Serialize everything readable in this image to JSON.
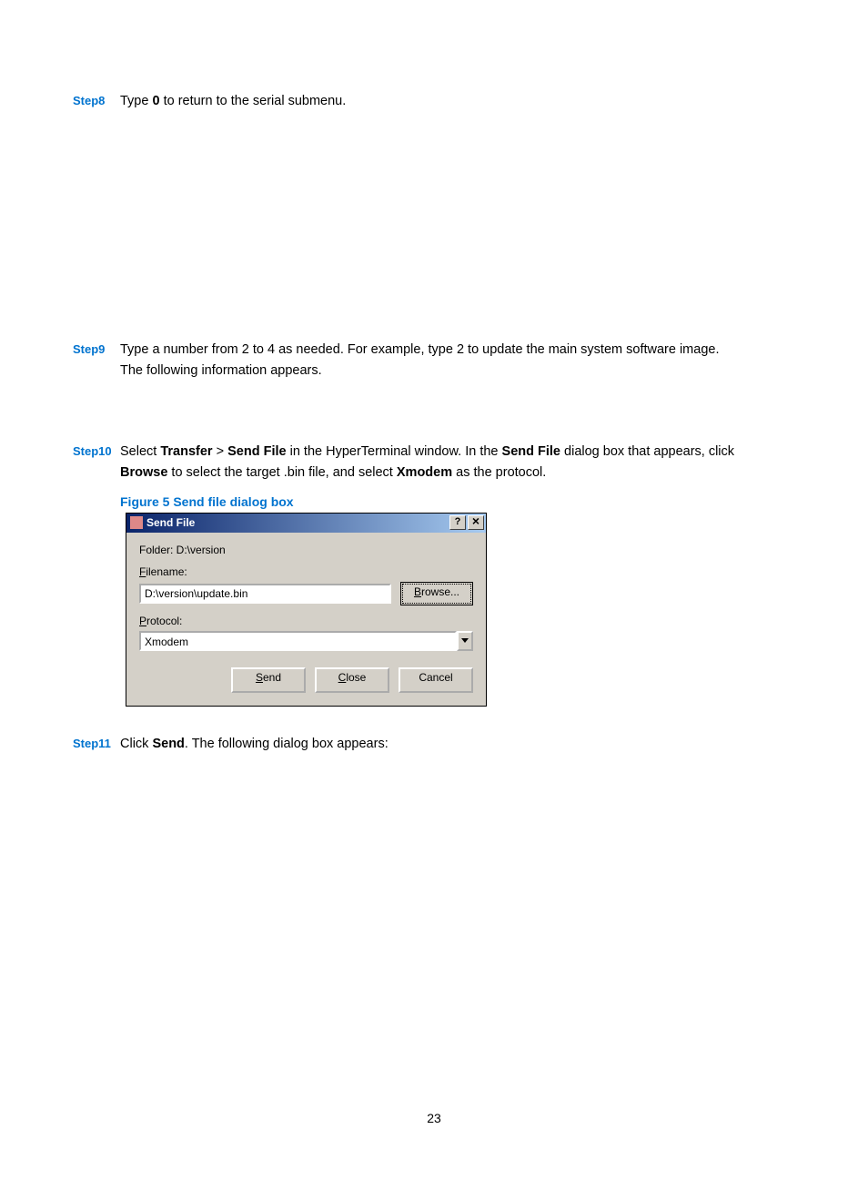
{
  "steps": {
    "s8": {
      "label": "Step8",
      "text_pre": "Type ",
      "key": "0",
      "text_post": " to return to the serial submenu."
    },
    "s9": {
      "label": "Step9",
      "line1": "Type a number from 2 to 4 as needed. For example, type 2 to update the main system software image.",
      "line2": "The following information appears."
    },
    "s10": {
      "label": "Step10",
      "p1_a": "Select ",
      "p1_transfer": "Transfer",
      "p1_gt": " > ",
      "p1_sendfile": "Send File",
      "p1_b": " in the HyperTerminal window. In the ",
      "p1_sendfile2": "Send File",
      "p1_c": " dialog box that appears, click ",
      "p2_browse": "Browse",
      "p2_a": " to select the target .bin file, and select ",
      "p2_xmodem": "Xmodem",
      "p2_b": " as the protocol."
    },
    "s11": {
      "label": "Step11",
      "pre": "Click ",
      "send": "Send",
      "post": ". The following dialog box appears:"
    }
  },
  "figure_caption": "Figure 5 Send file dialog box",
  "dialog": {
    "title": "Send File",
    "help": "?",
    "close": "×",
    "folder_label": "Folder: D:\\version",
    "filename_label_pre": "F",
    "filename_label_post": "ilename:",
    "filename_value": "D:\\version\\update.bin",
    "browse_pre": "B",
    "browse_post": "rowse...",
    "protocol_label_pre": "P",
    "protocol_label_post": "rotocol:",
    "protocol_value": "Xmodem",
    "send_pre": "S",
    "send_post": "end",
    "close_btn_pre": "C",
    "close_btn_post": "lose",
    "cancel": "Cancel"
  },
  "page_number": "23"
}
